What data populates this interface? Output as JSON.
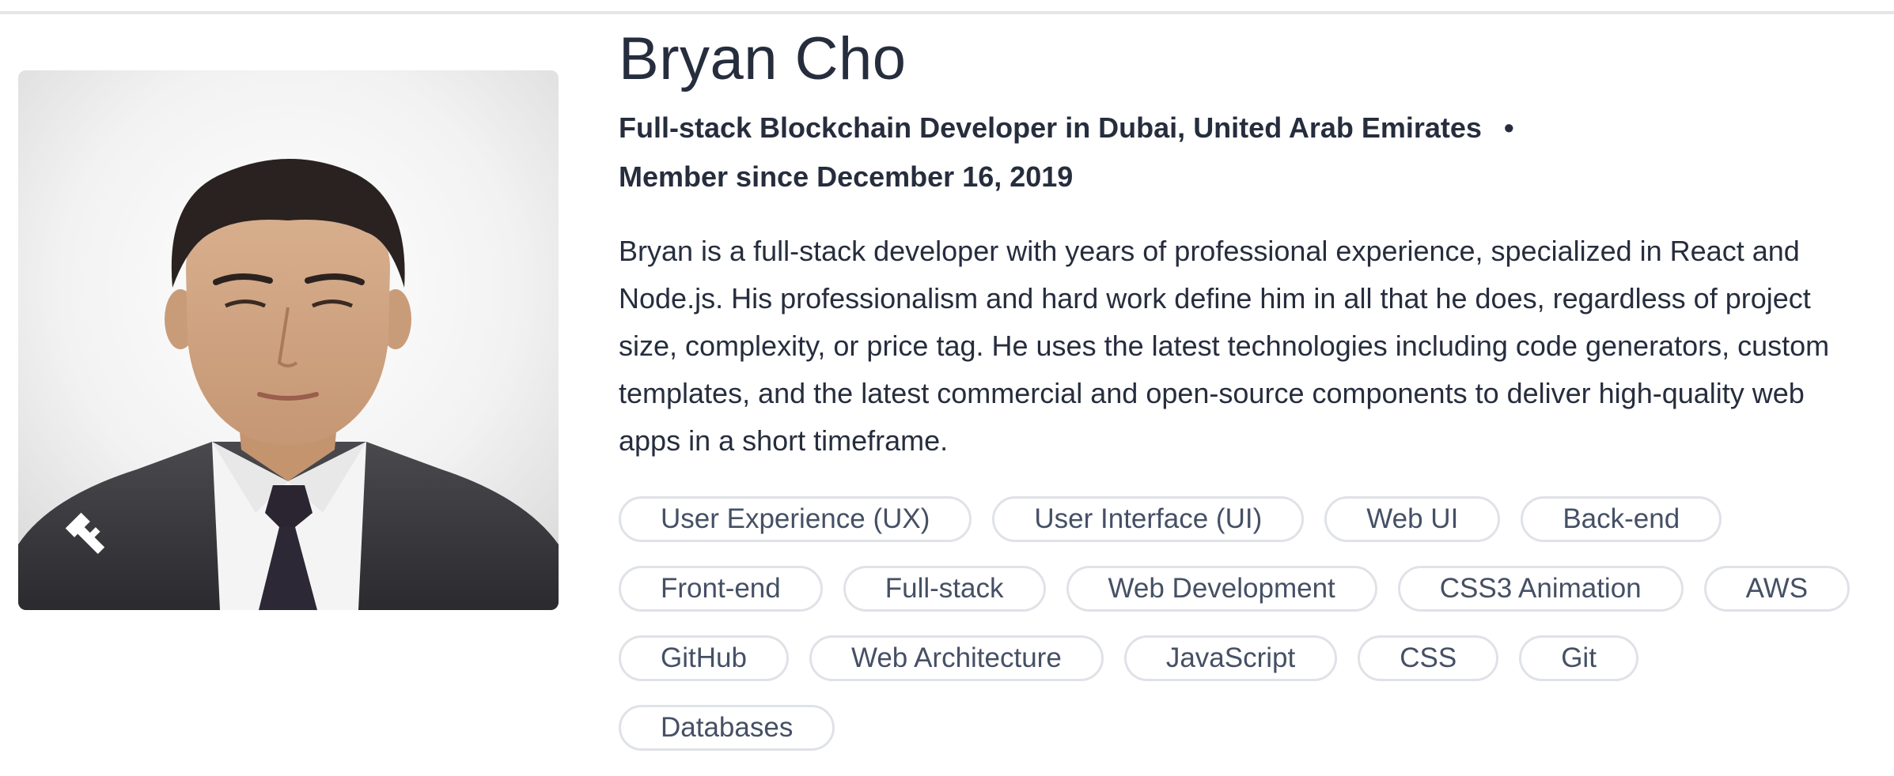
{
  "profile": {
    "name": "Bryan Cho",
    "headline": "Full-stack Blockchain Developer in Dubai, United Arab Emirates",
    "separator": "•",
    "member_since": "Member since December 16, 2019",
    "bio": "Bryan is a full-stack developer with years of professional experience, specialized in React and Node.js. His professionalism and hard work define him in all that he does, regardless of project size, complexity, or price tag. He uses the latest technologies including code generators, custom templates, and the latest commercial and open-source components to deliver high-quality web apps in a short timeframe.",
    "photo_badge_icon": "toptal-logo-icon"
  },
  "skills": [
    "User Experience (UX)",
    "User Interface (UI)",
    "Web UI",
    "Back-end",
    "Front-end",
    "Full-stack",
    "Web Development",
    "CSS3 Animation",
    "AWS",
    "GitHub",
    "Web Architecture",
    "JavaScript",
    "CSS",
    "Git",
    "Databases"
  ],
  "colors": {
    "text": "#262d3d",
    "tag_text": "#455065",
    "tag_border": "#dfe2e7",
    "divider": "#e4e5e8"
  }
}
